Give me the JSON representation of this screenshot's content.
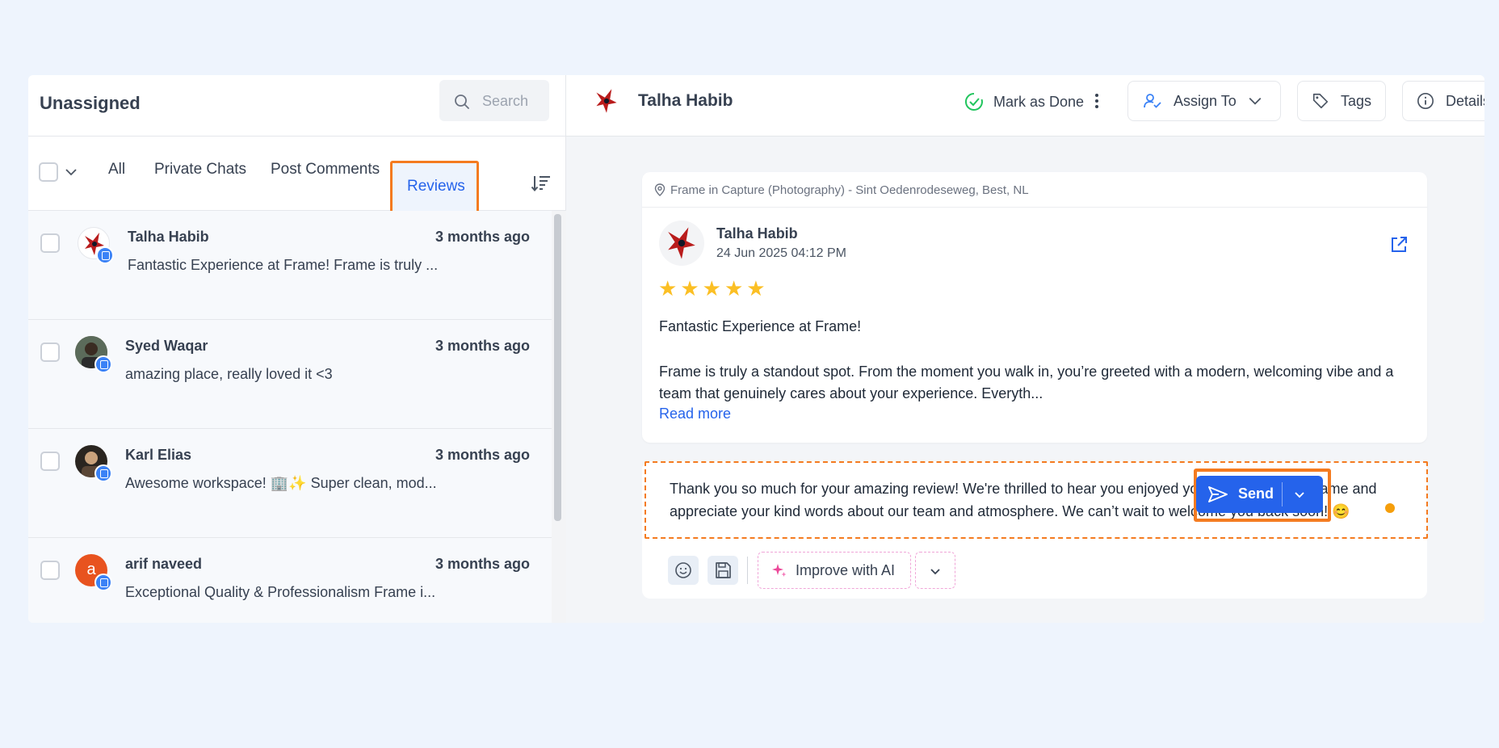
{
  "inbox": {
    "title": "Unassigned",
    "search_placeholder": "Search",
    "tabs": [
      {
        "label": "All"
      },
      {
        "label": "Private Chats"
      },
      {
        "label": "Post Comments"
      },
      {
        "label": "Reviews"
      }
    ],
    "active_tab": "Reviews",
    "conversations": [
      {
        "name": "Talha Habib",
        "time": "3 months ago",
        "preview": "Fantastic Experience at Frame! Frame is truly ...",
        "avatar": "dragon-avatar"
      },
      {
        "name": "Syed Waqar",
        "time": "3 months ago",
        "preview": "amazing place, really loved it <3",
        "avatar": "photo-avatar"
      },
      {
        "name": "Karl Elias",
        "time": "3 months ago",
        "preview": "Awesome workspace! 🏢✨ Super clean, mod...",
        "avatar": "photo-avatar"
      },
      {
        "name": "arif naveed",
        "time": "3 months ago",
        "preview": "Exceptional Quality & Professionalism Frame i...",
        "avatar_letter": "a",
        "avatar_color": "#e8531f"
      }
    ]
  },
  "conversation": {
    "contact_name": "Talha Habib",
    "mark_done_label": "Mark as Done",
    "assign_label": "Assign To",
    "tags_label": "Tags",
    "details_label": "Details"
  },
  "review": {
    "location": "Frame in Capture (Photography) - Sint Oedenrodeseweg, Best, NL",
    "author": "Talha Habib",
    "date": "24 Jun 2025 04:12 PM",
    "rating": 5,
    "star_color": "#fbbf24",
    "title": "Fantastic Experience at Frame!",
    "body": "Frame is truly a standout spot. From the moment you walk in, you’re greeted with a modern, welcoming vibe and a team that genuinely cares about your experience. Everyth...",
    "read_more": "Read more"
  },
  "reply": {
    "text": "Thank you so much for your amazing review! We're thrilled to hear you enjoyed your experience at Frame and appreciate your kind words about our team and atmosphere. We can’t wait to welcome you back soon! 😊",
    "improve_ai_label": "Improve with AI",
    "send_label": "Send"
  },
  "colors": {
    "accent": "#2563eb",
    "highlight": "#f47b20",
    "done_green": "#22c55e",
    "ai_pink": "#ec4899"
  }
}
